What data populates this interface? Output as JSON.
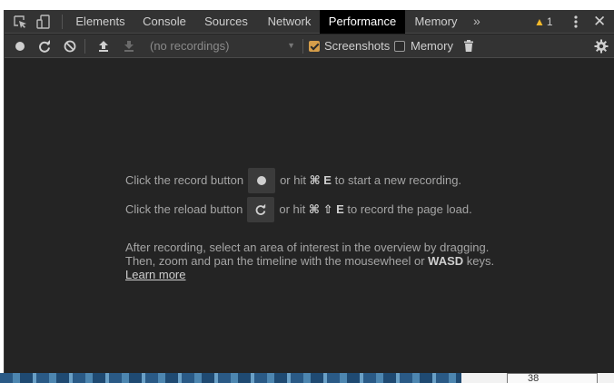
{
  "tabbar": {
    "tabs": [
      {
        "label": "Elements",
        "active": false
      },
      {
        "label": "Console",
        "active": false
      },
      {
        "label": "Sources",
        "active": false
      },
      {
        "label": "Network",
        "active": false
      },
      {
        "label": "Performance",
        "active": true
      },
      {
        "label": "Memory",
        "active": false
      }
    ],
    "overflow_label": "»",
    "warnings_count": "1",
    "close_label": "✕"
  },
  "toolbar": {
    "recordings_select": "(no recordings)",
    "screenshots_label": "Screenshots",
    "screenshots_checked": true,
    "memory_label": "Memory",
    "memory_checked": false
  },
  "landing": {
    "record_prefix": "Click the record button",
    "record_mid": "or hit",
    "record_keys": "⌘ E",
    "record_suffix": "to start a new recording.",
    "reload_prefix": "Click the reload button",
    "reload_mid": "or hit",
    "reload_keys": "⌘ ⇧ E",
    "reload_suffix": "to record the page load.",
    "after_line1": "After recording, select an area of interest in the overview by dragging.",
    "after_line2_prefix": "Then, zoom and pan the timeline with the mousewheel or",
    "after_line2_keys": "WASD",
    "after_line2_suffix": "keys.",
    "learn_more": "Learn more"
  },
  "background": {
    "page_number": "38"
  },
  "colors": {
    "panel_bg": "#242424",
    "toolbar_bg": "#333333",
    "active_tab_bg": "#000000",
    "checkbox_accent": "#d69e4a",
    "warning": "#f2b92a"
  }
}
